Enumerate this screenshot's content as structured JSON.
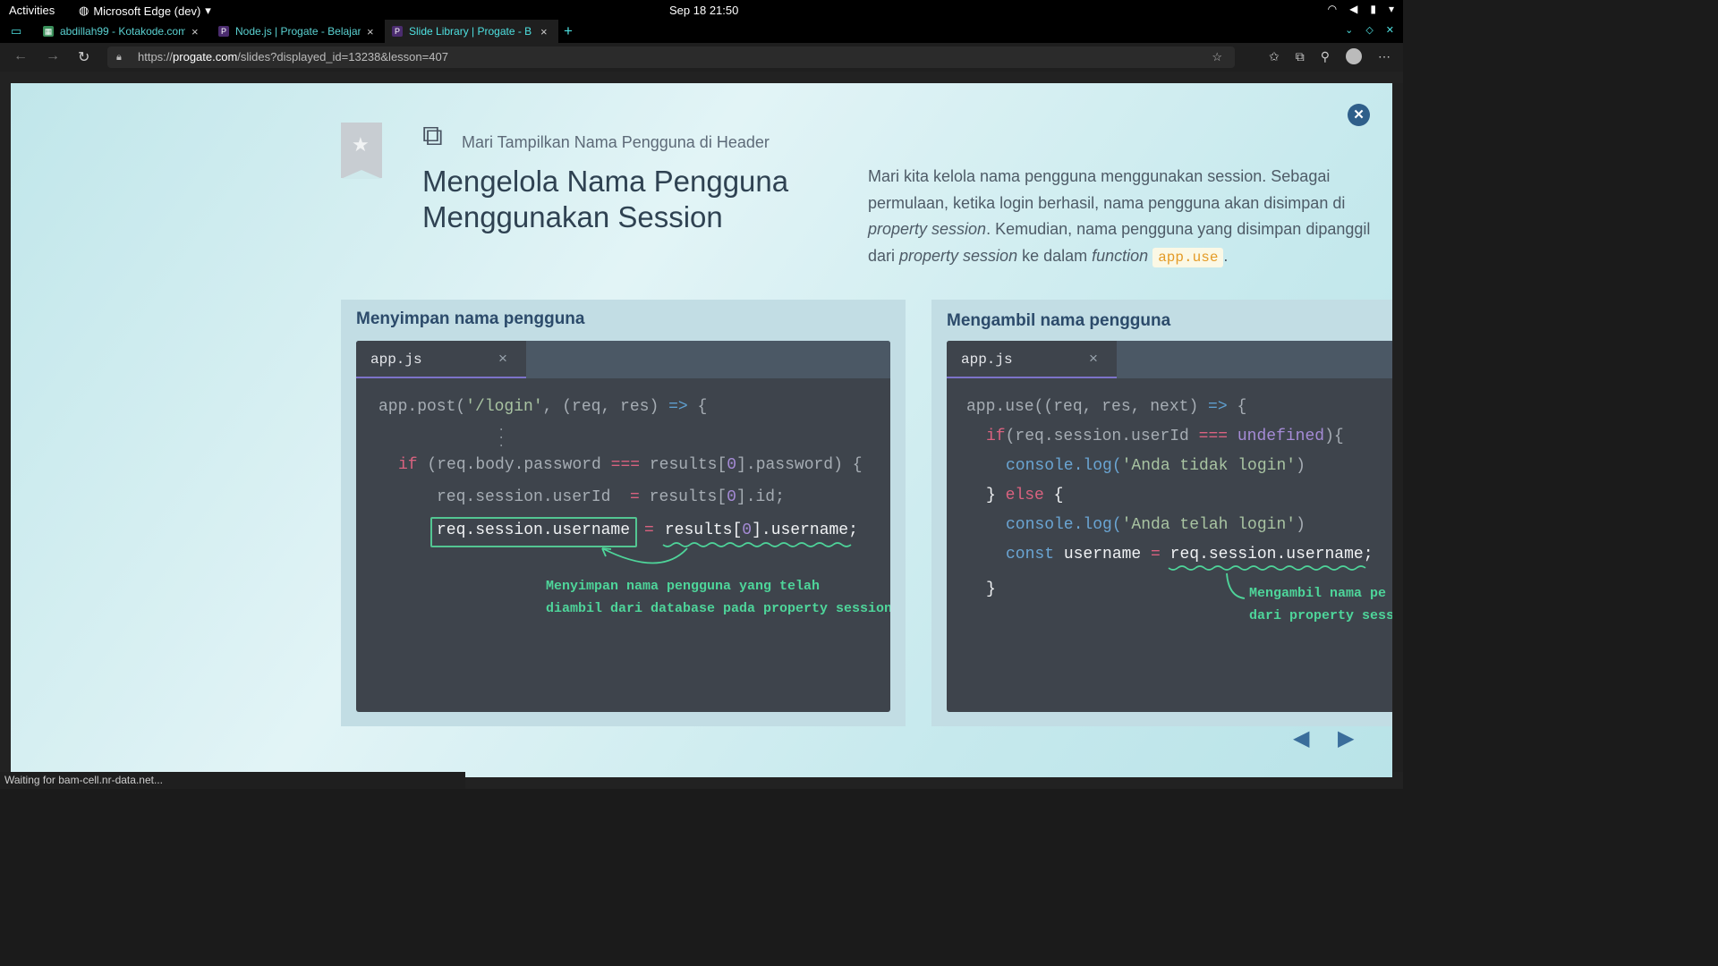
{
  "system_bar": {
    "activities": "Activities",
    "app_name": "Microsoft Edge (dev)",
    "datetime": "Sep 18  21:50"
  },
  "browser": {
    "tabs": [
      {
        "title": "abdillah99 - Kotakode.com",
        "active": false
      },
      {
        "title": "Node.js | Progate - Belajar",
        "active": false
      },
      {
        "title": "Slide Library | Progate - B",
        "active": true
      }
    ],
    "new_tab_label": "+",
    "url_prefix": "https://",
    "url_host": "progate.com",
    "url_path": "/slides?displayed_id=13238&lesson=407"
  },
  "slide": {
    "lesson_label": "Mari Tampilkan Nama Pengguna di Header",
    "title_line1": "Mengelola Nama Pengguna",
    "title_line2": "Menggunakan Session",
    "description": {
      "line1": "Mari kita kelola nama pengguna menggunakan session. Sebagai",
      "line2": "permulaan, ketika login berhasil, nama pengguna akan disimpan di",
      "line3_italic": "property session",
      "line3_rest": ". Kemudian, nama pengguna yang disimpan dipanggil",
      "line4_a": "dari ",
      "line4_italic1": "property session",
      "line4_b": " ke dalam ",
      "line4_italic2": "function",
      "line4_code": "app.use",
      "line4_end": "."
    },
    "left_panel": {
      "title": "Menyimpan nama pengguna",
      "file_tab": "app.js",
      "tab_close": "×",
      "code": {
        "l1_a": "app.post(",
        "l1_str": "'/login'",
        "l1_b": ", (req, res) ",
        "l1_arrow": "=>",
        "l1_c": " {",
        "l2_kw": "if",
        "l2_a": " (req.body.password ",
        "l2_op": "===",
        "l2_b": " results[",
        "l2_num": "0",
        "l2_c": "].password) {",
        "l3_a": "req.session.userId  ",
        "l3_op": "=",
        "l3_b": " results[",
        "l3_num": "0",
        "l3_c": "].id;",
        "l4_a": "req.session.username",
        "l4_op": "=",
        "l4_b": "results[",
        "l4_num": "0",
        "l4_c": "].username;"
      },
      "annotation_line1": "Menyimpan nama pengguna yang telah",
      "annotation_line2": "diambil dari database pada property session"
    },
    "right_panel": {
      "title": "Mengambil nama pengguna",
      "file_tab": "app.js",
      "tab_close": "×",
      "code": {
        "l1_a": "app.use((req, res, next) ",
        "l1_arrow": "=>",
        "l1_c": " {",
        "l2_kw": "if",
        "l2_a": "(req.session.userId ",
        "l2_op": "===",
        "l2_b": " ",
        "l2_undef": "undefined",
        "l2_c": "){",
        "l3_fn": "console.log(",
        "l3_str": "'Anda tidak login'",
        "l3_c": ")",
        "l4_a": "} ",
        "l4_kw": "else",
        "l4_c": " {",
        "l5_fn": "console.log(",
        "l5_str": "'Anda telah login'",
        "l5_c": ")",
        "l6_kw": "const",
        "l6_a": " username ",
        "l6_op": "=",
        "l6_b": " req.session.username;",
        "l7": "}"
      },
      "annotation_line1": "Mengambil nama pe",
      "annotation_line2": "dari property sessi"
    }
  },
  "status_text": "Waiting for bam-cell.nr-data.net..."
}
